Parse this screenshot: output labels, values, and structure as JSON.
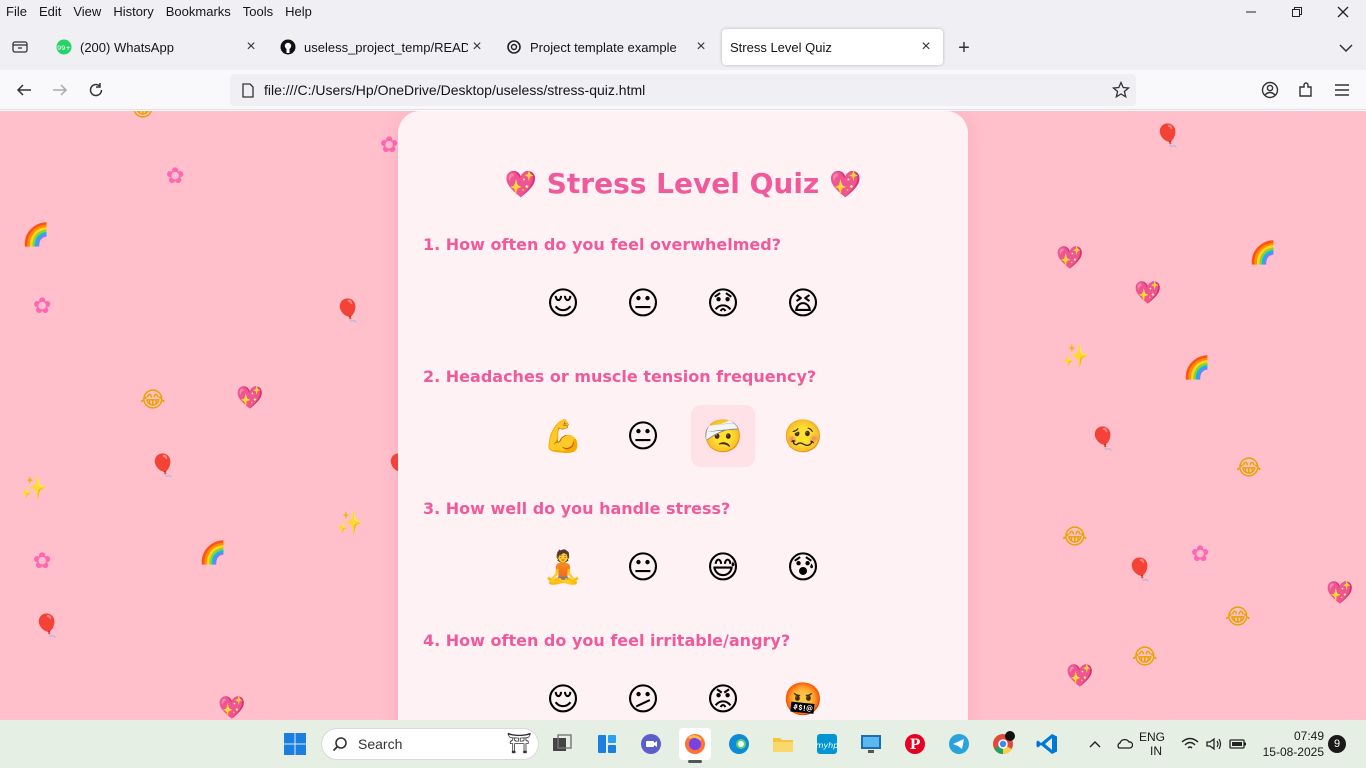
{
  "menu": {
    "items": [
      "File",
      "Edit",
      "View",
      "History",
      "Bookmarks",
      "Tools",
      "Help"
    ]
  },
  "tabs": [
    {
      "title": "(200) WhatsApp",
      "badge": "99+"
    },
    {
      "title": "useless_project_temp/README.m"
    },
    {
      "title": "Project template example"
    },
    {
      "title": "Stress Level Quiz"
    }
  ],
  "navbar": {
    "url": "file:///C:/Users/Hp/OneDrive/Desktop/useless/stress-quiz.html"
  },
  "quiz": {
    "title": "Stress Level Quiz",
    "title_emoji": "💖",
    "questions": [
      {
        "text": "1. How often do you feel overwhelmed?",
        "options": [
          "😌",
          "😐",
          "😟",
          "😫"
        ]
      },
      {
        "text": "2. Headaches or muscle tension frequency?",
        "options": [
          "💪",
          "😐",
          "🤕",
          "🥴"
        ]
      },
      {
        "text": "3. How well do you handle stress?",
        "options": [
          "🧘",
          "😐",
          "😅",
          "😰"
        ]
      },
      {
        "text": "4. How often do you feel irritable/angry?",
        "options": [
          "😌",
          "😕",
          "😡",
          "🤬"
        ]
      }
    ]
  },
  "taskbar": {
    "search_placeholder": "Search",
    "lang_primary": "ENG",
    "lang_secondary": "IN",
    "time": "07:49",
    "date": "15-08-2025",
    "notification_count": "9"
  }
}
